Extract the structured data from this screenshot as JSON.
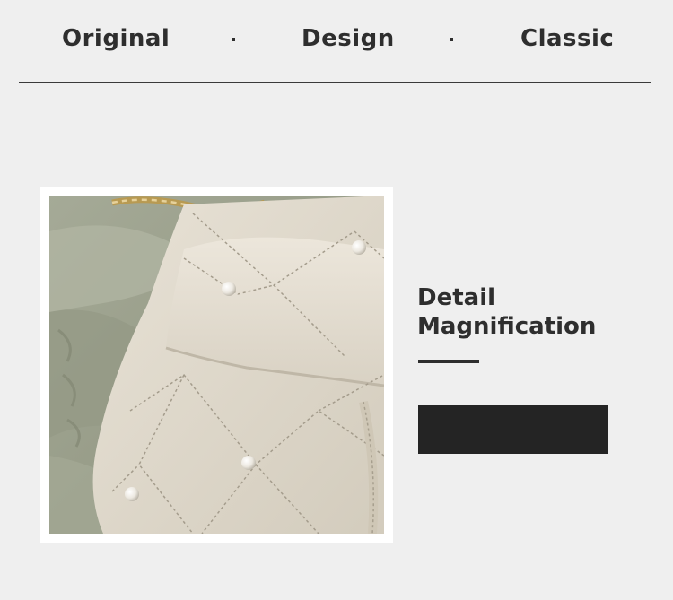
{
  "header": {
    "words": [
      "Original",
      "Design",
      "Classic"
    ]
  },
  "detail": {
    "line1": "Detail",
    "line2": "Magnification"
  },
  "colors": {
    "background": "#efefef",
    "text": "#2e2e2e",
    "label_box": "#242424"
  }
}
